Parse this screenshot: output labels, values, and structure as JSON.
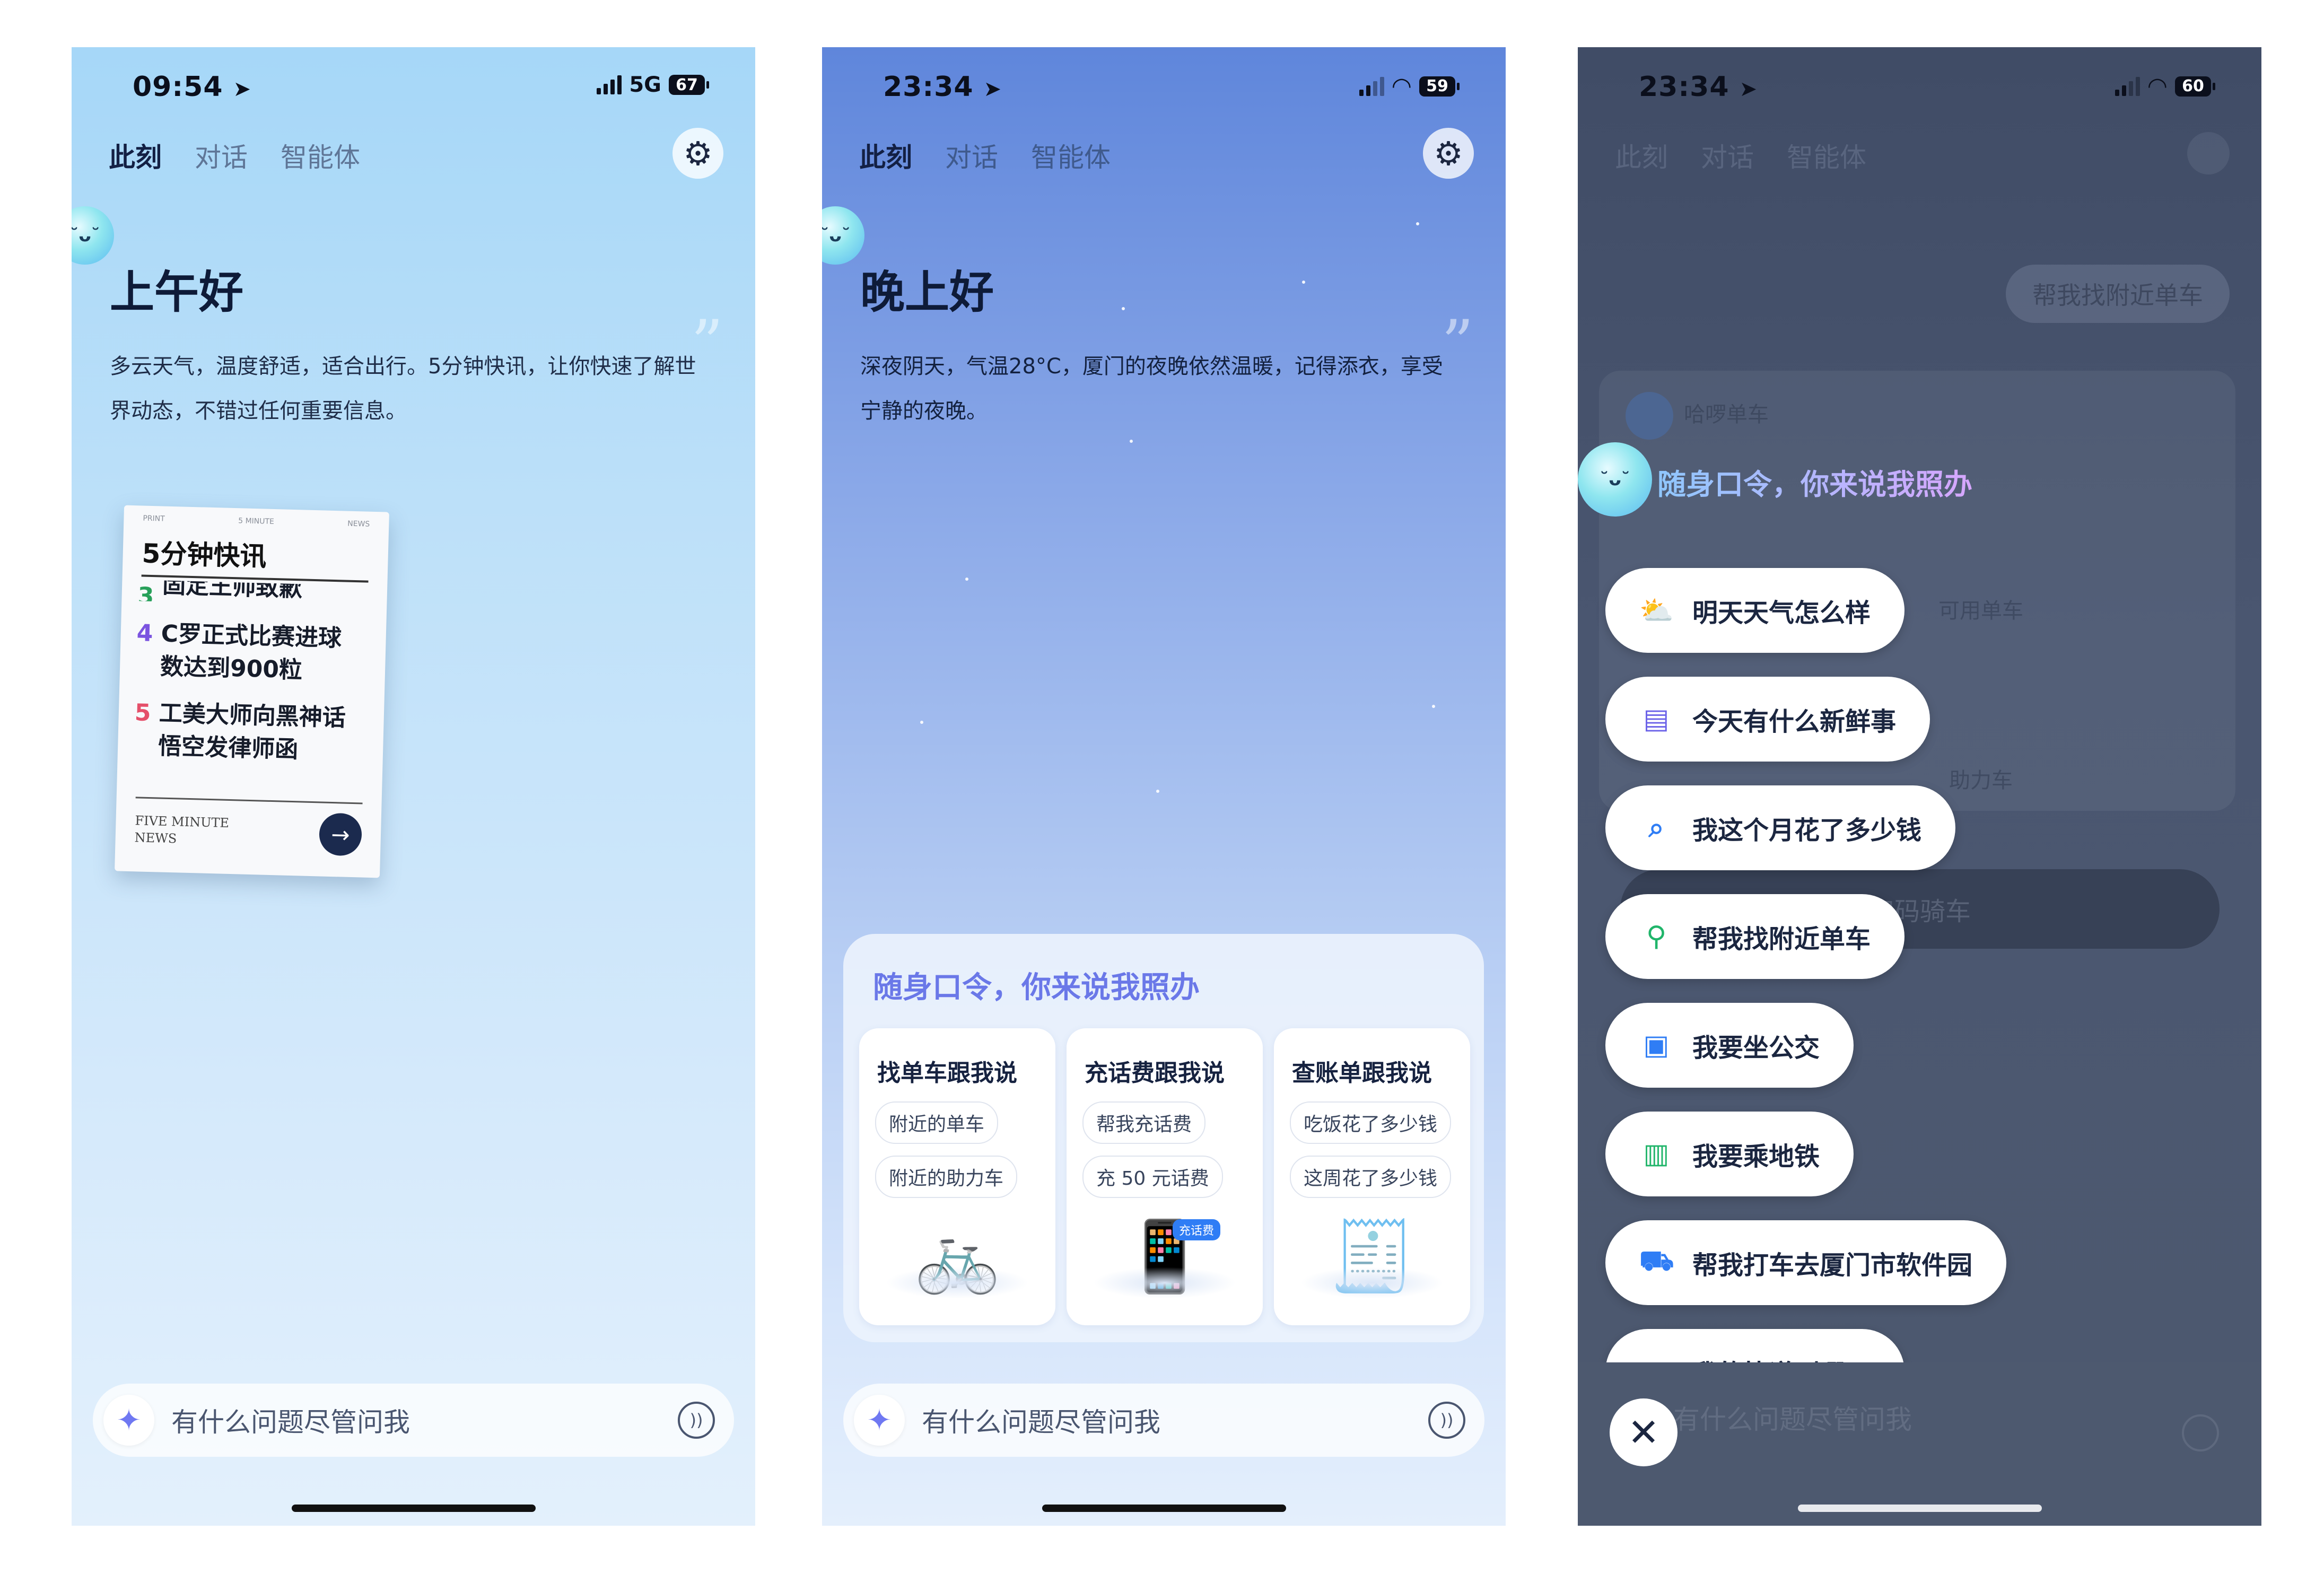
{
  "screen1": {
    "time": "09:54",
    "network": "5G",
    "battery": "67",
    "tabs": [
      "此刻",
      "对话",
      "智能体"
    ],
    "greeting": "上午好",
    "description": "多云天气，温度舒适，适合出行。5分钟快讯，让你快速了解世界动态，不错过任何重要信息。",
    "news_card": {
      "top_labels": [
        "PRINT",
        "5 MINUTE",
        "NEWS"
      ],
      "title": "5分钟快讯",
      "items": [
        {
          "num": "3",
          "text": "固定王帅致歉"
        },
        {
          "num": "4",
          "text": "C罗正式比赛进球数达到900粒"
        },
        {
          "num": "5",
          "text": "工美大师向黑神话悟空发律师函"
        }
      ],
      "footer": "FIVE MINUTE NEWS"
    },
    "input_placeholder": "有什么问题尽管问我"
  },
  "screen2": {
    "time": "23:34",
    "battery": "59",
    "tabs": [
      "此刻",
      "对话",
      "智能体"
    ],
    "greeting": "晚上好",
    "description": "深夜阴天，气温28°C，厦门的夜晚依然温暖，记得添衣，享受宁静的夜晚。",
    "panel_title": "随身口令，你来说我照办",
    "cards": [
      {
        "title": "找单车跟我说",
        "chips": [
          "附近的单车",
          "附近的助力车"
        ],
        "badge": ""
      },
      {
        "title": "充话费跟我说",
        "chips": [
          "帮我充话费",
          "充 50 元话费"
        ],
        "badge": "充话费"
      },
      {
        "title": "查账单跟我说",
        "chips": [
          "吃饭花了多少钱",
          "这周花了多少钱"
        ],
        "badge": ""
      }
    ],
    "input_placeholder": "有什么问题尽管问我"
  },
  "screen3": {
    "time": "23:34",
    "battery": "60",
    "background": {
      "tabs": [
        "此刻",
        "对话",
        "智能体"
      ],
      "bubble": "帮我找附近单车",
      "app_name": "哈啰单车",
      "map_label": "可用单车",
      "map_tag": "助力车",
      "ride_button": "扫码骑车"
    },
    "overlay_title": "随身口令，你来说我照办",
    "commands": [
      {
        "icon": "weather-icon",
        "label": "明天天气怎么样",
        "color": "#3a8cf0"
      },
      {
        "icon": "news-icon",
        "label": "今天有什么新鲜事",
        "color": "#6b62e8"
      },
      {
        "icon": "bill-search-icon",
        "label": "我这个月花了多少钱",
        "color": "#2f7df5"
      },
      {
        "icon": "bike-icon",
        "label": "帮我找附近单车",
        "color": "#20b56a"
      },
      {
        "icon": "bus-icon",
        "label": "我要坐公交",
        "color": "#2f7df5"
      },
      {
        "icon": "metro-icon",
        "label": "我要乘地铁",
        "color": "#20b56a"
      },
      {
        "icon": "car-icon",
        "label": "帮我打车去厦门市软件园",
        "color": "#2f7df5"
      },
      {
        "icon": "package-icon",
        "label": "我的快递到哪了",
        "color": "#e85a4a"
      }
    ],
    "input_placeholder": "有什么问题尽管问我"
  }
}
